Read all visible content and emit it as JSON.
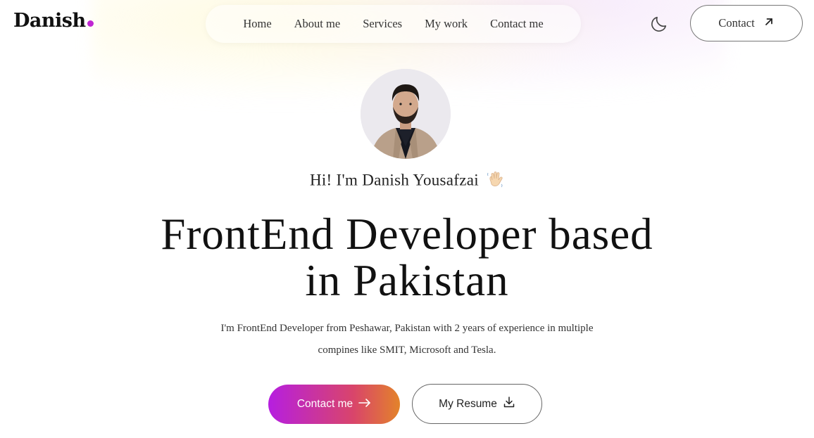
{
  "header": {
    "logo_text": "Danish",
    "nav": [
      "Home",
      "About me",
      "Services",
      "My work",
      "Contact me"
    ],
    "theme_toggle_icon": "moon-icon",
    "contact_button": "Contact",
    "contact_button_icon": "arrow-up-right-icon"
  },
  "hero": {
    "greeting": "Hi! I'm Danish Yousafzai",
    "greeting_icon": "waving-hand-icon",
    "headline_line1": "FrontEnd Developer based",
    "headline_line2": "in Pakistan",
    "intro_line1": "I'm FrontEnd Developer from Peshawar, Pakistan with 2 years of experience in multiple",
    "intro_line2": "compines like SMIT, Microsoft and Tesla.",
    "primary_button": "Contact me",
    "primary_button_icon": "arrow-right-icon",
    "secondary_button": "My Resume",
    "secondary_button_icon": "download-icon"
  },
  "colors": {
    "accent_dot": "#c026d3",
    "gradient_start": "#b61ee0",
    "gradient_end": "#e3832a"
  }
}
